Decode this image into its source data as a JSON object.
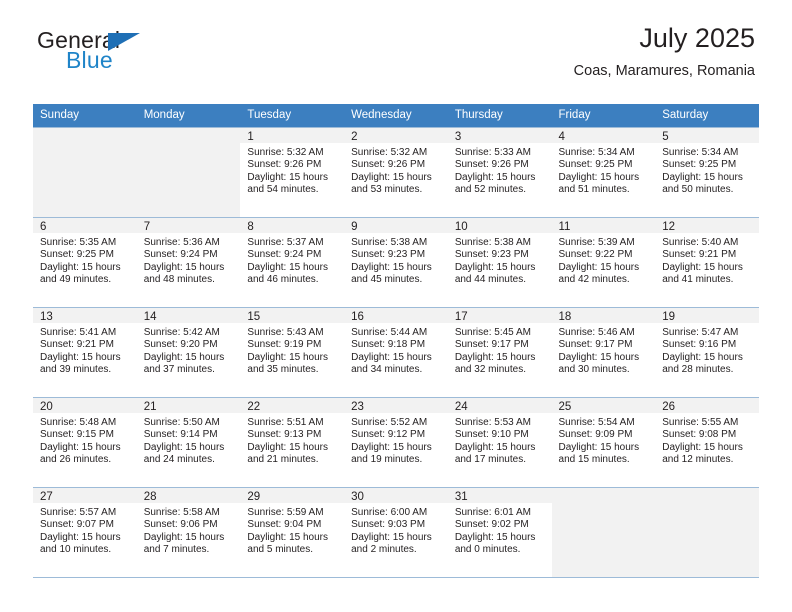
{
  "brand": {
    "name_top": "General",
    "name_bottom": "Blue",
    "triangle_color": "#1f6fb5",
    "blue_color": "#1f84c8"
  },
  "header": {
    "title": "July 2025",
    "location": "Coas, Maramures, Romania"
  },
  "theme": {
    "header_row_bg": "#3c7fc0",
    "header_row_text": "#ffffff",
    "grid_line": "#9dbbd8",
    "shaded_cell": "#f2f2f2",
    "text": "#231f20"
  },
  "weekday_headers": [
    "Sunday",
    "Monday",
    "Tuesday",
    "Wednesday",
    "Thursday",
    "Friday",
    "Saturday"
  ],
  "weeks": [
    [
      {
        "day": "",
        "detail": "",
        "empty": true
      },
      {
        "day": "",
        "detail": "",
        "empty": true
      },
      {
        "day": "1",
        "detail": "Sunrise: 5:32 AM\nSunset: 9:26 PM\nDaylight: 15 hours\nand 54 minutes."
      },
      {
        "day": "2",
        "detail": "Sunrise: 5:32 AM\nSunset: 9:26 PM\nDaylight: 15 hours\nand 53 minutes."
      },
      {
        "day": "3",
        "detail": "Sunrise: 5:33 AM\nSunset: 9:26 PM\nDaylight: 15 hours\nand 52 minutes."
      },
      {
        "day": "4",
        "detail": "Sunrise: 5:34 AM\nSunset: 9:25 PM\nDaylight: 15 hours\nand 51 minutes."
      },
      {
        "day": "5",
        "detail": "Sunrise: 5:34 AM\nSunset: 9:25 PM\nDaylight: 15 hours\nand 50 minutes."
      }
    ],
    [
      {
        "day": "6",
        "detail": "Sunrise: 5:35 AM\nSunset: 9:25 PM\nDaylight: 15 hours\nand 49 minutes."
      },
      {
        "day": "7",
        "detail": "Sunrise: 5:36 AM\nSunset: 9:24 PM\nDaylight: 15 hours\nand 48 minutes."
      },
      {
        "day": "8",
        "detail": "Sunrise: 5:37 AM\nSunset: 9:24 PM\nDaylight: 15 hours\nand 46 minutes."
      },
      {
        "day": "9",
        "detail": "Sunrise: 5:38 AM\nSunset: 9:23 PM\nDaylight: 15 hours\nand 45 minutes."
      },
      {
        "day": "10",
        "detail": "Sunrise: 5:38 AM\nSunset: 9:23 PM\nDaylight: 15 hours\nand 44 minutes."
      },
      {
        "day": "11",
        "detail": "Sunrise: 5:39 AM\nSunset: 9:22 PM\nDaylight: 15 hours\nand 42 minutes."
      },
      {
        "day": "12",
        "detail": "Sunrise: 5:40 AM\nSunset: 9:21 PM\nDaylight: 15 hours\nand 41 minutes."
      }
    ],
    [
      {
        "day": "13",
        "detail": "Sunrise: 5:41 AM\nSunset: 9:21 PM\nDaylight: 15 hours\nand 39 minutes."
      },
      {
        "day": "14",
        "detail": "Sunrise: 5:42 AM\nSunset: 9:20 PM\nDaylight: 15 hours\nand 37 minutes."
      },
      {
        "day": "15",
        "detail": "Sunrise: 5:43 AM\nSunset: 9:19 PM\nDaylight: 15 hours\nand 35 minutes."
      },
      {
        "day": "16",
        "detail": "Sunrise: 5:44 AM\nSunset: 9:18 PM\nDaylight: 15 hours\nand 34 minutes."
      },
      {
        "day": "17",
        "detail": "Sunrise: 5:45 AM\nSunset: 9:17 PM\nDaylight: 15 hours\nand 32 minutes."
      },
      {
        "day": "18",
        "detail": "Sunrise: 5:46 AM\nSunset: 9:17 PM\nDaylight: 15 hours\nand 30 minutes."
      },
      {
        "day": "19",
        "detail": "Sunrise: 5:47 AM\nSunset: 9:16 PM\nDaylight: 15 hours\nand 28 minutes."
      }
    ],
    [
      {
        "day": "20",
        "detail": "Sunrise: 5:48 AM\nSunset: 9:15 PM\nDaylight: 15 hours\nand 26 minutes."
      },
      {
        "day": "21",
        "detail": "Sunrise: 5:50 AM\nSunset: 9:14 PM\nDaylight: 15 hours\nand 24 minutes."
      },
      {
        "day": "22",
        "detail": "Sunrise: 5:51 AM\nSunset: 9:13 PM\nDaylight: 15 hours\nand 21 minutes."
      },
      {
        "day": "23",
        "detail": "Sunrise: 5:52 AM\nSunset: 9:12 PM\nDaylight: 15 hours\nand 19 minutes."
      },
      {
        "day": "24",
        "detail": "Sunrise: 5:53 AM\nSunset: 9:10 PM\nDaylight: 15 hours\nand 17 minutes."
      },
      {
        "day": "25",
        "detail": "Sunrise: 5:54 AM\nSunset: 9:09 PM\nDaylight: 15 hours\nand 15 minutes."
      },
      {
        "day": "26",
        "detail": "Sunrise: 5:55 AM\nSunset: 9:08 PM\nDaylight: 15 hours\nand 12 minutes."
      }
    ],
    [
      {
        "day": "27",
        "detail": "Sunrise: 5:57 AM\nSunset: 9:07 PM\nDaylight: 15 hours\nand 10 minutes."
      },
      {
        "day": "28",
        "detail": "Sunrise: 5:58 AM\nSunset: 9:06 PM\nDaylight: 15 hours\nand 7 minutes."
      },
      {
        "day": "29",
        "detail": "Sunrise: 5:59 AM\nSunset: 9:04 PM\nDaylight: 15 hours\nand 5 minutes."
      },
      {
        "day": "30",
        "detail": "Sunrise: 6:00 AM\nSunset: 9:03 PM\nDaylight: 15 hours\nand 2 minutes."
      },
      {
        "day": "31",
        "detail": "Sunrise: 6:01 AM\nSunset: 9:02 PM\nDaylight: 15 hours\nand 0 minutes."
      },
      {
        "day": "",
        "detail": "",
        "empty": true
      },
      {
        "day": "",
        "detail": "",
        "empty": true
      }
    ]
  ]
}
